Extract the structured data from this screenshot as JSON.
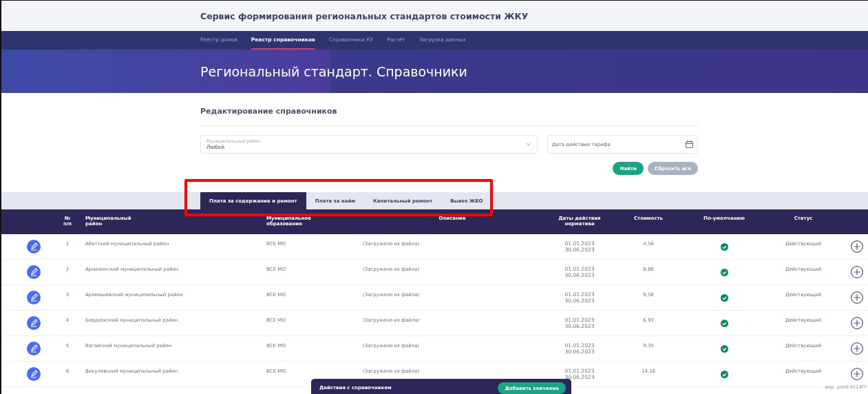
{
  "app_title": "Сервис формирования региональных стандартов стоимости ЖКУ",
  "nav": [
    {
      "label": "Реестр домов",
      "selected": false
    },
    {
      "label": "Реестр справочников",
      "selected": true
    },
    {
      "label": "Справочники КУ",
      "selected": false
    },
    {
      "label": "Расчёт",
      "selected": false
    },
    {
      "label": "Загрузка данных",
      "selected": false
    }
  ],
  "page_title": "Региональный стандарт. Справочники",
  "section_title": "Редактирование справочников",
  "filters": {
    "district": {
      "label": "Муниципальный район",
      "value": "Любой"
    },
    "date": {
      "placeholder": "Дата действия тарифа"
    }
  },
  "buttons": [
    {
      "label": "Найти",
      "kind": "primary"
    },
    {
      "label": "Сбросить все",
      "kind": "secondary"
    }
  ],
  "tabs": [
    {
      "label": "Плата за содержание и ремонт",
      "selected": true
    },
    {
      "label": "Плата за найм",
      "selected": false
    },
    {
      "label": "Капитальный ремонт",
      "selected": false
    },
    {
      "label": "Вывоз ЖБО",
      "selected": false
    }
  ],
  "table": {
    "columns": [
      "№\nп/п",
      "Муниципальный\nрайон",
      "Муниципальное\nобразование",
      "Описание",
      "Даты действия\nнорматива",
      "Стоимость",
      "По-умолчанию",
      "Статус"
    ],
    "rows": [
      {
        "number": "1",
        "district": "Абатский муниципальный район",
        "municipality": "ВСЕ МО",
        "description": "(Загружено из файла)",
        "dates": [
          "01.01.2023",
          "30.06.2023"
        ],
        "cost": "4,58",
        "default": true,
        "status": "Действующий"
      },
      {
        "number": "2",
        "district": "Армизонский муниципальный район",
        "municipality": "ВСЕ МО",
        "description": "(Загружено из файла)",
        "dates": [
          "01.01.2023",
          "30.06.2023"
        ],
        "cost": "8,88",
        "default": true,
        "status": "Действующий"
      },
      {
        "number": "3",
        "district": "Аромашевский муниципальный район",
        "municipality": "ВСЕ МО",
        "description": "(Загружено из файла)",
        "dates": [
          "01.01.2023",
          "30.06.2023"
        ],
        "cost": "9,58",
        "default": true,
        "status": "Действующий"
      },
      {
        "number": "4",
        "district": "Бердюжский муниципальный район",
        "municipality": "ВСЕ МО",
        "description": "(Загружено из файла)",
        "dates": [
          "01.01.2023",
          "30.06.2023"
        ],
        "cost": "6,93",
        "default": true,
        "status": "Действующий"
      },
      {
        "number": "5",
        "district": "Вагайский муниципальный район",
        "municipality": "ВСЕ МО",
        "description": "(Загружено из файла)",
        "dates": [
          "01.01.2023",
          "30.06.2023"
        ],
        "cost": "9,35",
        "default": true,
        "status": "Действующий"
      },
      {
        "number": "6",
        "district": "Викуловский муниципальный район",
        "municipality": "ВСЕ МО",
        "description": "(Загружено из файла)",
        "dates": [
          "01.01.2023",
          "30.06.2023"
        ],
        "cost": "14,16",
        "default": true,
        "status": "Действующий"
      }
    ]
  },
  "action_bar": {
    "title": "Действия с справочником",
    "button": "Добавить значение"
  },
  "version": "вер. prod:4114f7"
}
